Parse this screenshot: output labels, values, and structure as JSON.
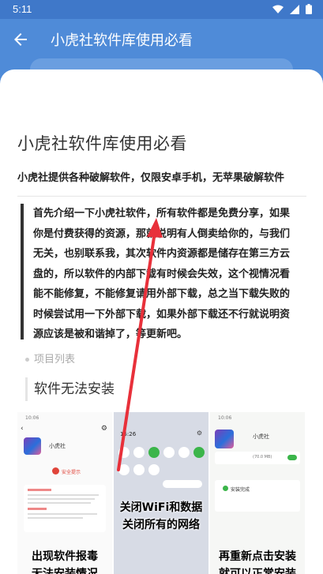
{
  "status": {
    "time": "5:11"
  },
  "appbar": {
    "title": "小虎社软件库使用必看"
  },
  "article": {
    "title": "小虎社软件库使用必看",
    "subtitle": "小虎社提供各种破解软件，仅限安卓手机，无苹果破解软件",
    "quote_lines": [
      "首先介绍一下小虎社软件，所有软件都是免费分享，如果",
      "你是付费获得的资源，那就说明有人倒卖给你的，与我们",
      "无关，也别联系我，其次软件内资源都是储存在第三方云",
      "盘的，所以软件的内部下载有时候会失效，这个视情况看",
      "能不能修复，不能修复请用外部下载，总之当下载失败的",
      "时候尝试用一下外部下载，如果外部下载还不行就说明资",
      "源应该是被和谐掉了，等更新吧。"
    ],
    "list_item": "项目列表",
    "section_title": "软件无法安装"
  },
  "shots": [
    {
      "time": "10:06",
      "app_label": "小虎社",
      "warning": "安全提示",
      "caption_lines": [
        "出现软件报毒",
        "无法安装情况"
      ]
    },
    {
      "time": "15:26",
      "caption_lines": [
        "关闭WiFi和数据",
        "关闭所有的网络"
      ]
    },
    {
      "time": "10:06",
      "app_label": "小虎社",
      "size_text": "(70.0 MB)",
      "done_text": "安装完成",
      "caption_lines": [
        "再重新点击安装",
        "就可以正常安装"
      ]
    }
  ],
  "colors": {
    "appbar": "#4f8bd8",
    "statusbar": "#3f78c9",
    "arrow": "#e8303a"
  }
}
